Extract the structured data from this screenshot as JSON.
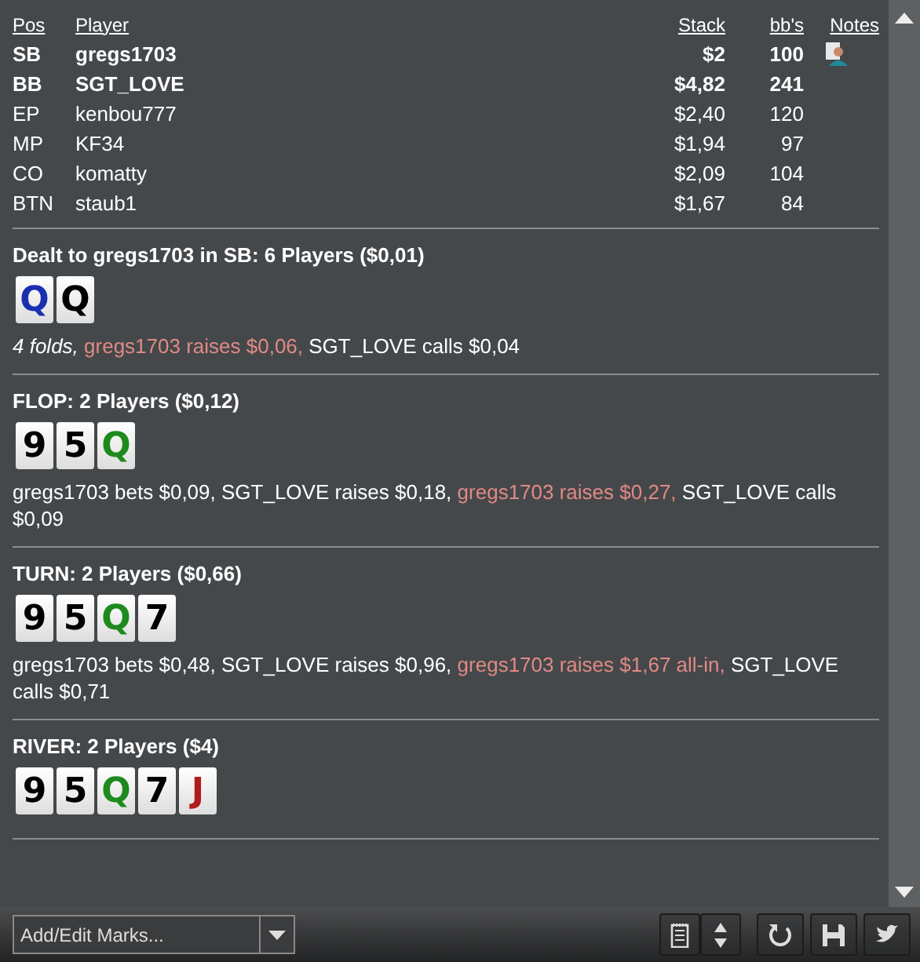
{
  "table": {
    "columns": [
      "Pos",
      "Player",
      "Stack",
      "bb's",
      "Notes"
    ],
    "rows": [
      {
        "pos": "SB",
        "player": "gregs1703",
        "stack": "$2",
        "bbs": "100",
        "bold": true,
        "has_note": true
      },
      {
        "pos": "BB",
        "player": "SGT_LOVE",
        "stack": "$4,82",
        "bbs": "241",
        "bold": true,
        "has_note": false
      },
      {
        "pos": "EP",
        "player": "kenbou777",
        "stack": "$2,40",
        "bbs": "120",
        "bold": false,
        "has_note": false
      },
      {
        "pos": "MP",
        "player": "KF34",
        "stack": "$1,94",
        "bbs": "97",
        "bold": false,
        "has_note": false
      },
      {
        "pos": "CO",
        "player": "komatty",
        "stack": "$2,09",
        "bbs": "104",
        "bold": false,
        "has_note": false
      },
      {
        "pos": "BTN",
        "player": "staub1",
        "stack": "$1,67",
        "bbs": "84",
        "bold": false,
        "has_note": false
      }
    ]
  },
  "streets": [
    {
      "title": "Dealt to gregs1703 in SB: 6 Players ($0,01)",
      "cards": [
        {
          "rank": "Q",
          "color": "#1a2fb0"
        },
        {
          "rank": "Q",
          "color": "#000000"
        }
      ],
      "actions": [
        {
          "text": "4 folds, ",
          "kind": "folds"
        },
        {
          "text": "gregs1703 raises $0,06, ",
          "kind": "hero"
        },
        {
          "text": "SGT_LOVE calls $0,04",
          "kind": "other"
        }
      ]
    },
    {
      "title": "FLOP: 2 Players ($0,12)",
      "cards": [
        {
          "rank": "9",
          "color": "#000000"
        },
        {
          "rank": "5",
          "color": "#000000"
        },
        {
          "rank": "Q",
          "color": "#1e8a1e"
        }
      ],
      "actions": [
        {
          "text": "gregs1703 bets $0,09, SGT_LOVE raises $0,18, ",
          "kind": "other"
        },
        {
          "text": "gregs1703 raises $0,27, ",
          "kind": "hero"
        },
        {
          "text": "SGT_LOVE calls $0,09",
          "kind": "other"
        }
      ]
    },
    {
      "title": "TURN: 2 Players ($0,66)",
      "cards": [
        {
          "rank": "9",
          "color": "#000000"
        },
        {
          "rank": "5",
          "color": "#000000"
        },
        {
          "rank": "Q",
          "color": "#1e8a1e"
        },
        {
          "rank": "7",
          "color": "#000000"
        }
      ],
      "actions": [
        {
          "text": "gregs1703 bets $0,48, SGT_LOVE raises $0,96, ",
          "kind": "other"
        },
        {
          "text": "gregs1703 raises $1,67 all-in, ",
          "kind": "hero"
        },
        {
          "text": "SGT_LOVE calls $0,71",
          "kind": "other"
        }
      ]
    },
    {
      "title": "RIVER: 2 Players ($4)",
      "cards": [
        {
          "rank": "9",
          "color": "#000000"
        },
        {
          "rank": "5",
          "color": "#000000"
        },
        {
          "rank": "Q",
          "color": "#1e8a1e"
        },
        {
          "rank": "7",
          "color": "#000000"
        },
        {
          "rank": "J",
          "color": "#b01c1c"
        }
      ]
    }
  ],
  "toolbar": {
    "marks_placeholder": "Add/Edit Marks..."
  }
}
